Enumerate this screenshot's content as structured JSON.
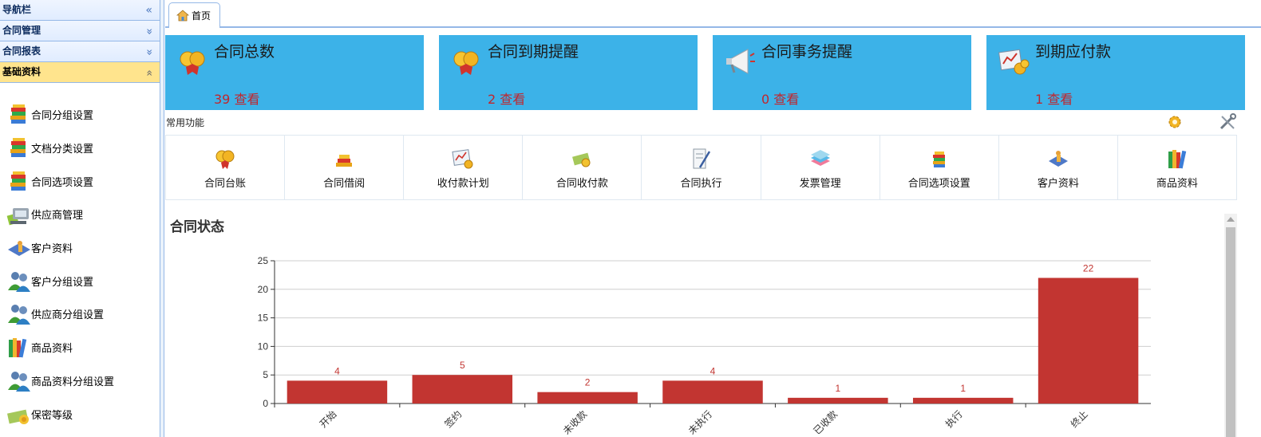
{
  "sidebar": {
    "headers": [
      {
        "label": "导航栏",
        "chevron": "«"
      },
      {
        "label": "合同管理",
        "chevron": "»"
      },
      {
        "label": "合同报表",
        "chevron": "»"
      },
      {
        "label": "基础资料",
        "chevron": "«"
      }
    ],
    "items": [
      {
        "label": "合同分组设置",
        "icon": "book-stack-icon"
      },
      {
        "label": "文档分类设置",
        "icon": "book-stack-icon"
      },
      {
        "label": "合同选项设置",
        "icon": "book-stack-icon"
      },
      {
        "label": "供应商管理",
        "icon": "supplier-icon"
      },
      {
        "label": "客户资料",
        "icon": "customer-icon"
      },
      {
        "label": "客户分组设置",
        "icon": "users-group-icon"
      },
      {
        "label": "供应商分组设置",
        "icon": "users-group-icon"
      },
      {
        "label": "商品资料",
        "icon": "books-icon"
      },
      {
        "label": "商品资料分组设置",
        "icon": "users-group-icon"
      },
      {
        "label": "保密等级",
        "icon": "money-icon"
      }
    ]
  },
  "tabs": {
    "home_label": "首页",
    "home_icon": "home-icon"
  },
  "stats": [
    {
      "title": "合同总数",
      "value": "39",
      "link": "查看",
      "icon": "coins-badge-icon"
    },
    {
      "title": "合同到期提醒",
      "value": "2",
      "link": "查看",
      "icon": "coins-badge-icon"
    },
    {
      "title": "合同事务提醒",
      "value": "0",
      "link": "查看",
      "icon": "megaphone-icon"
    },
    {
      "title": "到期应付款",
      "value": "1",
      "link": "查看",
      "icon": "chart-coins-icon"
    }
  ],
  "common": {
    "title": "常用功能",
    "tools": [
      "gear-icon",
      "tools-icon"
    ],
    "items": [
      {
        "label": "合同台账",
        "icon": "coins-badge-icon"
      },
      {
        "label": "合同借阅",
        "icon": "book-stack-icon"
      },
      {
        "label": "收付款计划",
        "icon": "chart-coins-icon"
      },
      {
        "label": "合同收付款",
        "icon": "money-icon"
      },
      {
        "label": "合同执行",
        "icon": "scroll-icon"
      },
      {
        "label": "发票管理",
        "icon": "invoice-icon"
      },
      {
        "label": "合同选项设置",
        "icon": "book-stack-icon"
      },
      {
        "label": "客户资料",
        "icon": "customer-icon"
      },
      {
        "label": "商品资料",
        "icon": "books-icon"
      }
    ]
  },
  "colors": {
    "card": "#3cb2e8",
    "bar": "#c23531",
    "stat_value": "#c0262d"
  },
  "chart_title": "合同状态",
  "chart_data": {
    "type": "bar",
    "title": "合同状态",
    "categories": [
      "开始",
      "签约",
      "未收款",
      "未执行",
      "已收款",
      "执行",
      "终止"
    ],
    "values": [
      4,
      5,
      2,
      4,
      1,
      1,
      22
    ],
    "ylim": [
      0,
      25
    ],
    "yticks": [
      0,
      5,
      10,
      15,
      20,
      25
    ],
    "xlabel": "",
    "ylabel": "",
    "grid": true,
    "data_labels": true
  }
}
